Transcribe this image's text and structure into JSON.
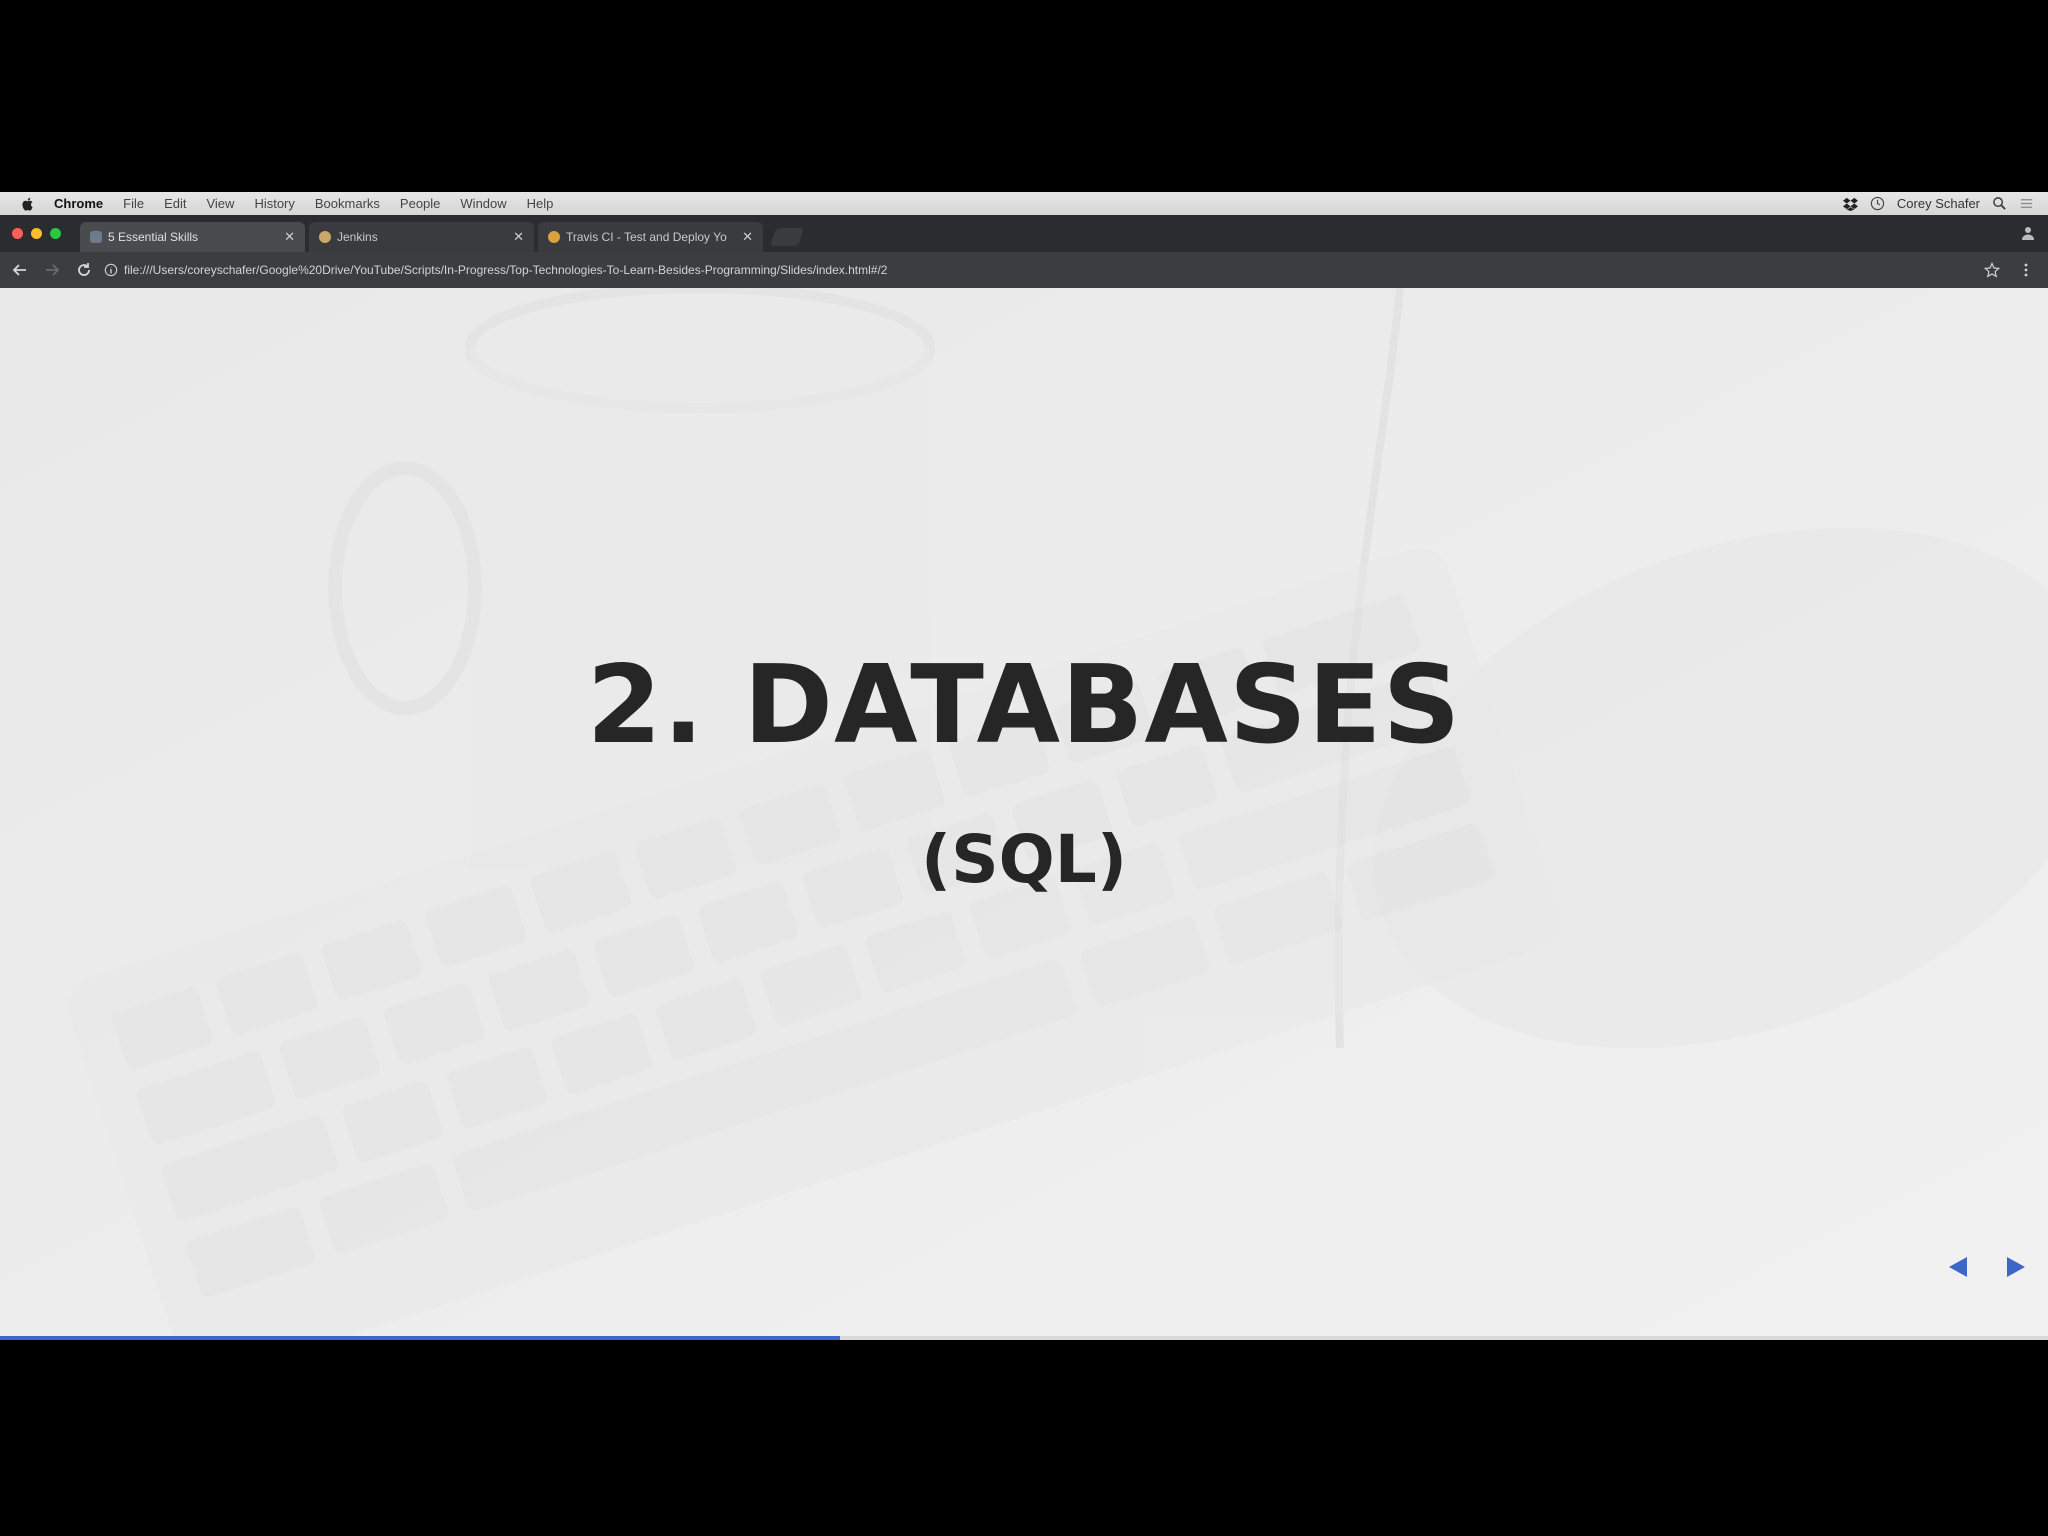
{
  "menubar": {
    "app": "Chrome",
    "items": [
      "File",
      "Edit",
      "View",
      "History",
      "Bookmarks",
      "People",
      "Window",
      "Help"
    ],
    "user": "Corey Schafer"
  },
  "tabs": [
    {
      "title": "5 Essential Skills",
      "fav_color": "#6c7a89",
      "active": true
    },
    {
      "title": "Jenkins",
      "fav_color": "#c9a86a",
      "active": false
    },
    {
      "title": "Travis CI - Test and Deploy Yo",
      "fav_color": "#d9a23a",
      "active": false
    }
  ],
  "toolbar": {
    "url": "file:///Users/coreyschafer/Google%20Drive/YouTube/Scripts/In-Progress/Top-Technologies-To-Learn-Besides-Programming/Slides/index.html#/2"
  },
  "slide": {
    "title": "2. DATABASES",
    "subtitle": "(SQL)",
    "progress_fraction": 0.41
  },
  "colors": {
    "accent": "#3c67c8",
    "traffic_red": "#fc5f57",
    "traffic_yellow": "#fdbc2e",
    "traffic_green": "#28c840"
  }
}
